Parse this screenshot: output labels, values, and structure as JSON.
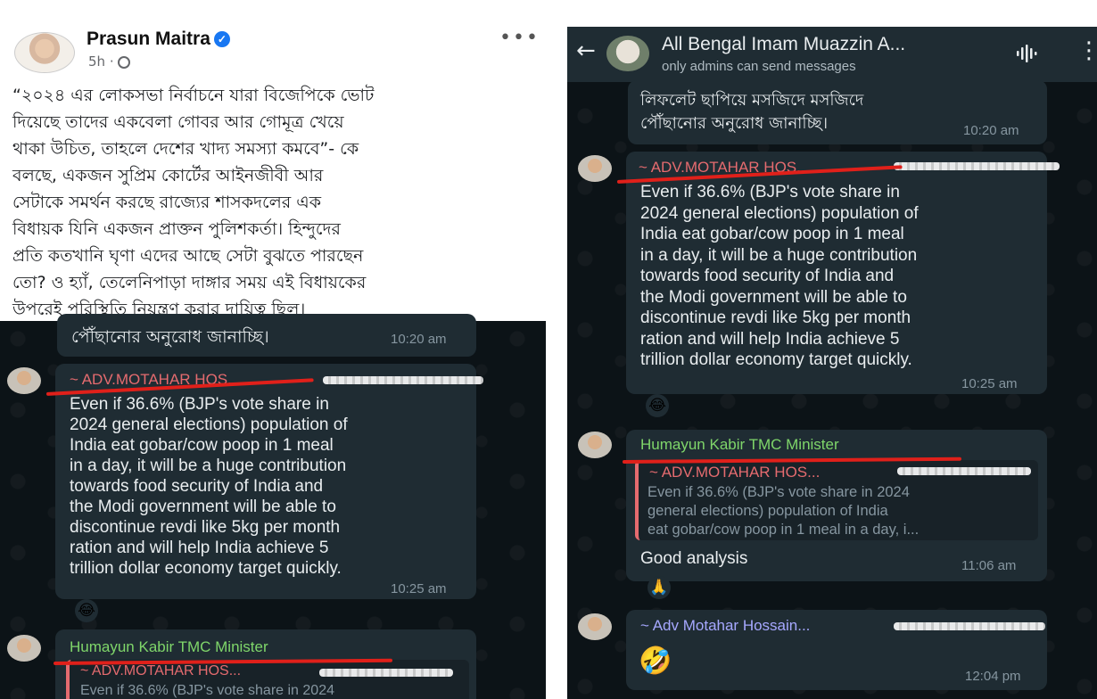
{
  "fb": {
    "author": "Prasun Maitra",
    "time": "5h ·",
    "more": "•••",
    "post_lines": [
      "“২০২৪ এর লোকসভা নির্বাচনে যারা বিজেপিকে ভোট",
      "দিয়েছে তাদের একবেলা গোবর আর গোমূত্র খেয়ে",
      "থাকা উচিত, তাহলে দেশের খাদ্য সমস্যা কমবে”- কে",
      "বলছে, একজন সুপ্রিম কোর্টের আইনজীবী আর",
      "সেটাকে সমর্থন করছে রাজ্যের শাসকদলের এক",
      "বিধায়ক যিনি একজন প্রাক্তন পুলিশকর্তা। হিন্দুদের",
      "প্রতি কতখানি ঘৃণা এদের আছে সেটা বুঝতে পারছেন",
      "তো? ও হ্যাঁ, তেলেনিপাড়া দাঙ্গার সময় এই বিধায়কের",
      "উপরেই পরিস্থিতি নিয়ন্ত্রণ করার দায়িত্ব ছিল।"
    ]
  },
  "left_chat": {
    "prev_msg_tail": "পৌঁছানোর অনুরোধ জানাচ্ছি।",
    "prev_time": "10:20 am",
    "msg1": {
      "sender": "~ ADV.MOTAHAR HOS...",
      "lines": [
        "Even if 36.6% (BJP's vote share in",
        "2024 general elections) population of",
        "India eat gobar/cow poop in 1 meal",
        "in a day, it will be a huge contribution",
        "towards food security of India and",
        "the Modi government will be able to",
        "discontinue revdi like 5kg per month",
        "ration and will help India achieve 5",
        "trillion dollar economy target quickly."
      ],
      "time": "10:25 am",
      "reaction": "😂"
    },
    "msg2": {
      "sender": "Humayun Kabir TMC Minister",
      "quote_sender": "~ ADV.MOTAHAR HOS...",
      "quote_text": "Even if 36.6% (BJP's vote share in 2024"
    }
  },
  "right_chat": {
    "header": {
      "group_name": "All Bengal Imam Muazzin A...",
      "subtitle": "only admins can send messages",
      "back_icon": "←",
      "menu_icon": "⋮"
    },
    "prev_msg_lines": [
      "লিফলেট ছাপিয়ে মসজিদে মসজিদে",
      "পৌঁছানোর অনুরোধ জানাচ্ছি।"
    ],
    "prev_time": "10:20 am",
    "msg1": {
      "sender": "~ ADV.MOTAHAR HOS...",
      "lines": [
        "Even if 36.6% (BJP's vote share in",
        "2024 general elections) population of",
        "India eat gobar/cow poop in 1 meal",
        "in a day, it will be a huge contribution",
        "towards food security of India and",
        "the Modi government will be able to",
        "discontinue revdi like 5kg per month",
        "ration and will help India achieve 5",
        "trillion dollar economy target quickly."
      ],
      "time": "10:25 am",
      "reaction": "😂"
    },
    "msg2": {
      "sender": "Humayun Kabir TMC Minister",
      "quote_sender": "~ ADV.MOTAHAR HOS...",
      "quote_lines": [
        "Even if 36.6% (BJP's vote share in 2024",
        "general elections) population of India",
        "eat gobar/cow poop in 1 meal in a day, i..."
      ],
      "text": "Good analysis",
      "time": "11:06 am",
      "reaction": "🙏"
    },
    "msg3": {
      "sender": "~ Adv Motahar Hossain...",
      "emoji": "🤣",
      "time": "12:04 pm"
    }
  },
  "colors": {
    "chat_bg": "#0c1317",
    "bubble": "#1f2c33",
    "sender_red": "#e56b6f",
    "sender_green": "#7fd66a",
    "sender_purple": "#a6a8ff",
    "time_gray": "#8696a0",
    "fb_blue": "#1877f2",
    "red_underline": "#e0201a"
  }
}
